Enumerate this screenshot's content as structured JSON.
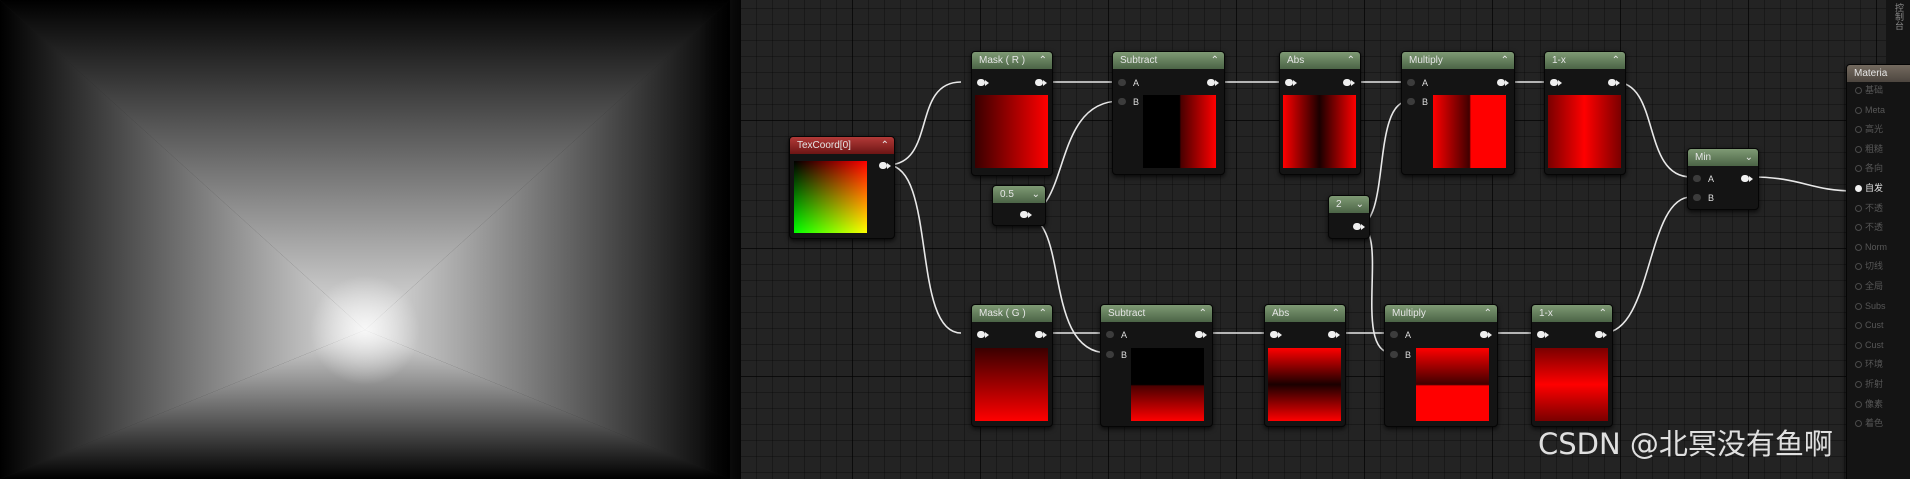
{
  "nodes": {
    "texcoord": {
      "title": "TexCoord[0]"
    },
    "mask_r": {
      "title": "Mask ( R )"
    },
    "mask_g": {
      "title": "Mask ( G )"
    },
    "const_half": {
      "value": "0.5"
    },
    "const_two": {
      "value": "2"
    },
    "subtract_top": {
      "title": "Subtract",
      "pin_a": "A",
      "pin_b": "B"
    },
    "subtract_bottom": {
      "title": "Subtract",
      "pin_a": "A",
      "pin_b": "B"
    },
    "abs_top": {
      "title": "Abs"
    },
    "abs_bottom": {
      "title": "Abs"
    },
    "multiply_top": {
      "title": "Multiply",
      "pin_a": "A",
      "pin_b": "B"
    },
    "multiply_bottom": {
      "title": "Multiply",
      "pin_a": "A",
      "pin_b": "B"
    },
    "one_minus_top": {
      "title": "1-x"
    },
    "one_minus_bottom": {
      "title": "1-x"
    },
    "min": {
      "title": "Min",
      "pin_a": "A",
      "pin_b": "B"
    }
  },
  "material_node": {
    "title": "Materia",
    "inputs": [
      "基础",
      "Meta",
      "高光",
      "粗糙",
      "各向",
      "自发",
      "不透",
      "不透",
      "Norm",
      "切线",
      "全局",
      "Subs",
      "Cust",
      "Cust",
      "环境",
      "折射",
      "像素",
      "着色"
    ],
    "active_input": "自发"
  },
  "side_panel": {
    "text": "控制台"
  },
  "watermark": "CSDN @北冥没有鱼啊",
  "colors": {
    "node_header": "#5d7a55",
    "texcoord_header": "#8c2220",
    "preview_red": "#ff0000",
    "wire": "#e8e8e8"
  }
}
